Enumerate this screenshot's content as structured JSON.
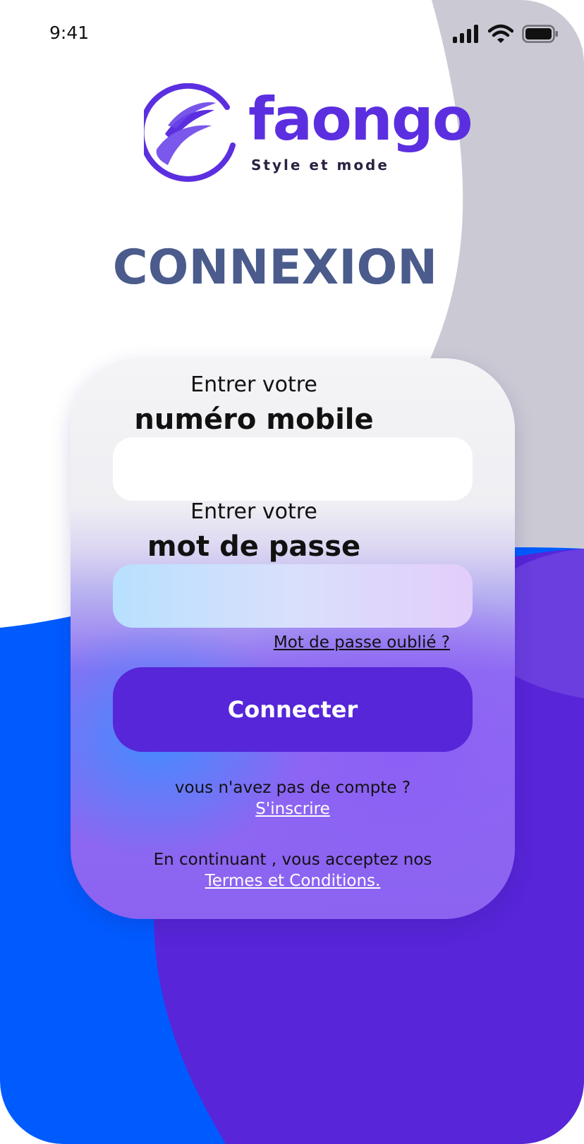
{
  "status_bar": {
    "time": "9:41"
  },
  "brand": {
    "name": "faongo",
    "tagline": "Style et mode"
  },
  "page": {
    "title": "CONNEXION"
  },
  "form": {
    "phone_label_1": "Entrer votre",
    "phone_label_2": "numéro mobile",
    "phone_value": "",
    "password_label_1": "Entrer votre",
    "password_label_2": "mot de passe",
    "password_value": "",
    "forgot_link": "Mot de passe oublié ?",
    "submit_label": "Connecter",
    "no_account_text": "vous n'avez pas de compte ?",
    "signup_link": "S'inscrire",
    "terms_text": "En continuant , vous acceptez nos",
    "terms_link": "Termes et Conditions."
  },
  "colors": {
    "brand_purple": "#5b2fe0",
    "button": "#5626d8",
    "title": "#4a5b8c",
    "bg_blue": "#005bff",
    "bg_purple": "#5825d8",
    "bg_gray": "#cbcad4"
  },
  "icons": [
    "signal-icon",
    "wifi-icon",
    "battery-icon",
    "faongo-logo-icon"
  ]
}
